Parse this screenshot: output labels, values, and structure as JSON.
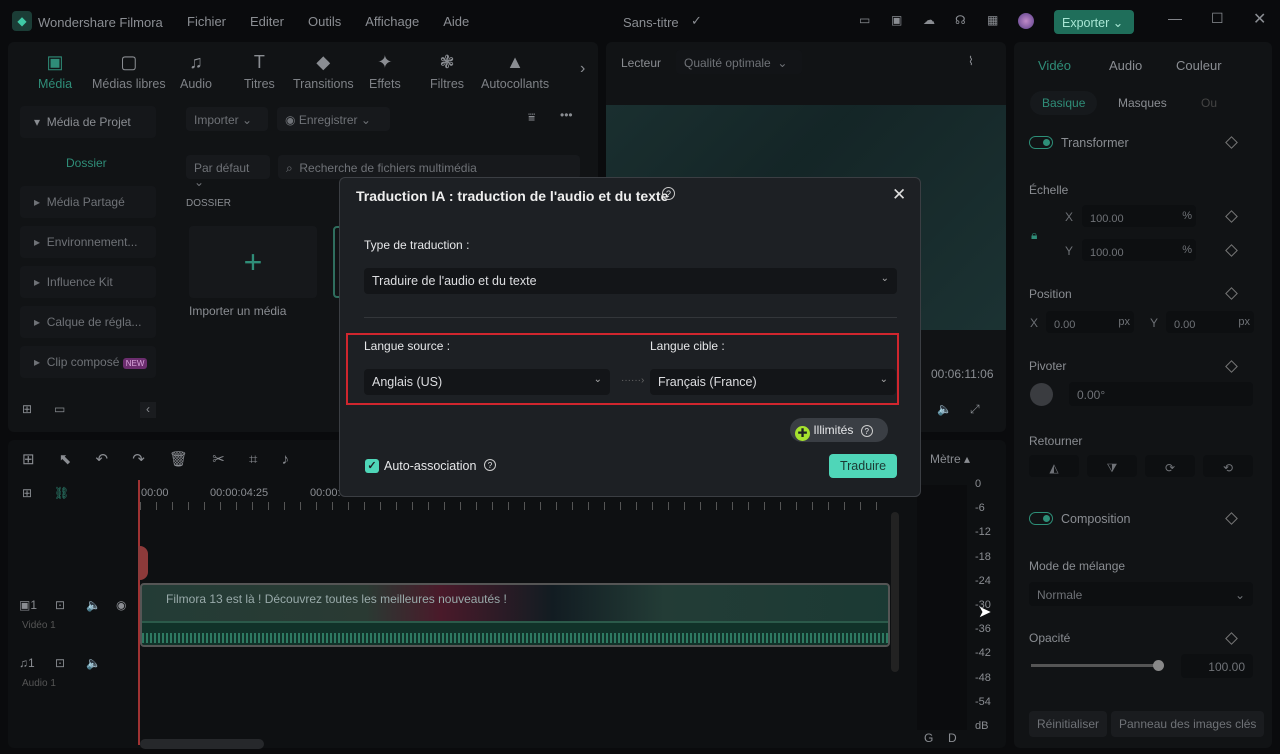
{
  "app": {
    "title": "Wondershare Filmora",
    "menu": [
      "Fichier",
      "Editer",
      "Outils",
      "Affichage",
      "Aide"
    ],
    "project": "Sans-titre",
    "export": "Exporter"
  },
  "toolbar": [
    {
      "label": "Média",
      "icon": "media-icon"
    },
    {
      "label": "Médias libres",
      "icon": "folder-icon"
    },
    {
      "label": "Audio",
      "icon": "music-icon"
    },
    {
      "label": "Titres",
      "icon": "title-icon"
    },
    {
      "label": "Transitions",
      "icon": "transitions-icon"
    },
    {
      "label": "Effets",
      "icon": "effects-icon"
    },
    {
      "label": "Filtres",
      "icon": "filters-icon"
    },
    {
      "label": "Autocollants",
      "icon": "stickers-icon"
    }
  ],
  "sidebar": {
    "items": [
      "Média de Projet",
      "Dossier",
      "Média Partagé",
      "Environnement...",
      "Influence Kit",
      "Calque de régla...",
      "Clip composé"
    ],
    "new_badge": "NEW"
  },
  "media": {
    "import": "Importer",
    "record": "Enregistrer",
    "sort": "Par défaut",
    "search_placeholder": "Recherche de fichiers multimédia",
    "folder_label": "DOSSIER",
    "import_media": "Importer un média"
  },
  "player": {
    "label": "Lecteur",
    "quality": "Qualité optimale",
    "time": "00:06:11:06"
  },
  "right": {
    "tabs": [
      "Vidéo",
      "Audio",
      "Couleur"
    ],
    "subtabs": [
      "Basique",
      "Masques",
      "Ou"
    ],
    "transform": "Transformer",
    "scale": "Échelle",
    "scale_x": "100.00",
    "scale_y": "100.00",
    "pct": "%",
    "position": "Position",
    "pos_x": "0.00",
    "pos_y": "0.00",
    "px": "px",
    "rotate": "Pivoter",
    "rotate_val": "0.00°",
    "flip": "Retourner",
    "composition": "Composition",
    "blend": "Mode de mélange",
    "blend_val": "Normale",
    "opacity": "Opacité",
    "opacity_val": "100.00",
    "opacity_level": 1.0,
    "reset": "Réinitialiser",
    "keyframes": "Panneau des images clés"
  },
  "timeline": {
    "ticks": [
      "00:00",
      "00:00:04:25",
      "00:00:"
    ],
    "clip_title": "Filmora 13 est là ! Découvrez toutes les meilleures nouveautés !",
    "video_track": "Vidéo 1",
    "audio_track": "Audio 1",
    "meter_label": "Mètre",
    "meter_scale": [
      "0",
      "-6",
      "-12",
      "-18",
      "-24",
      "-30",
      "-36",
      "-42",
      "-48",
      "-54",
      "dB"
    ],
    "gd": [
      "G",
      "D"
    ]
  },
  "dialog": {
    "title": "Traduction IA : traduction de l'audio et du texte",
    "type_label": "Type de traduction :",
    "type_value": "Traduire de l'audio et du texte",
    "source_label": "Langue source :",
    "source_value": "Anglais (US)",
    "target_label": "Langue cible :",
    "target_value": "Français (France)",
    "credits": "Illimités",
    "auto": "Auto-association",
    "auto_checked": true,
    "translate": "Traduire"
  },
  "colors": {
    "accent": "#4fd6b8",
    "highlight": "#d0262e",
    "export": "#1f6e5a"
  }
}
